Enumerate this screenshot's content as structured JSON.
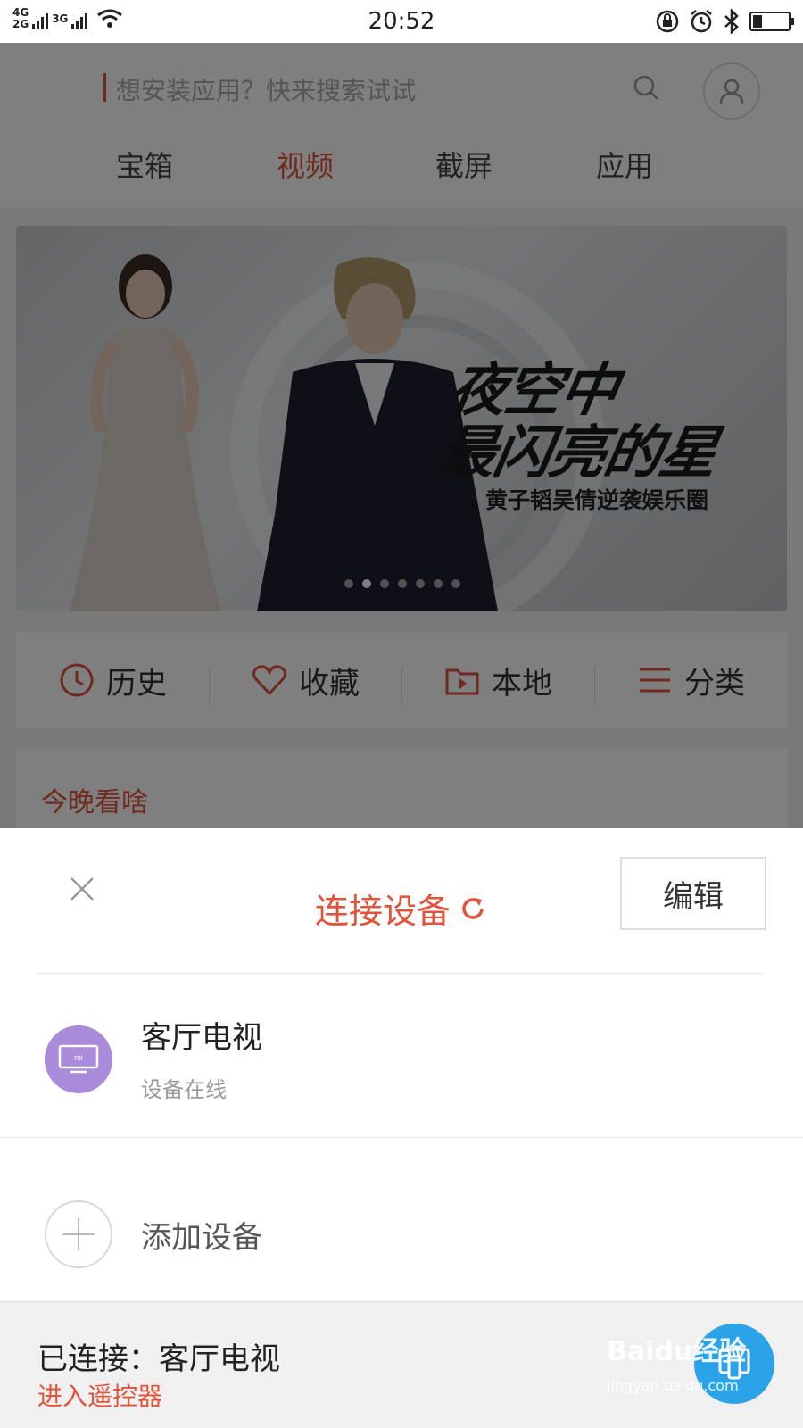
{
  "status_bar": {
    "network_top": "4G",
    "network_bottom": "2G",
    "network_3g": "3G",
    "time": "20:52",
    "battery_level": 0.25
  },
  "search": {
    "placeholder": "想安装应用？快来搜索试试"
  },
  "tabs": [
    {
      "label": "宝箱",
      "active": false
    },
    {
      "label": "视频",
      "active": true
    },
    {
      "label": "截屏",
      "active": false
    },
    {
      "label": "应用",
      "active": false
    }
  ],
  "banner": {
    "title_line1": "夜空中",
    "title_line2": "最闪亮的星",
    "subtitle": "黄子韬吴倩逆袭娱乐圈",
    "slide_count": 7,
    "active_slide": 1
  },
  "quick_actions": [
    {
      "label": "历史",
      "icon": "clock-icon"
    },
    {
      "label": "收藏",
      "icon": "heart-icon"
    },
    {
      "label": "本地",
      "icon": "folder-play-icon"
    },
    {
      "label": "分类",
      "icon": "list-icon"
    }
  ],
  "tonight": {
    "title": "今晚看啥"
  },
  "sheet": {
    "title": "连接设备",
    "edit_label": "编辑",
    "devices": [
      {
        "name": "客厅电视",
        "status": "设备在线",
        "logo_text": "mi"
      }
    ],
    "add_label": "添加设备",
    "connected_text": "已连接：客厅电视",
    "remote_link": "进入遥控器"
  },
  "watermark": {
    "main": "Baidu经验",
    "sub": "jingyan.baidu.com"
  },
  "colors": {
    "accent": "#e0543a",
    "device_avatar": "#a98bd9",
    "fab": "#2aa3e8"
  }
}
